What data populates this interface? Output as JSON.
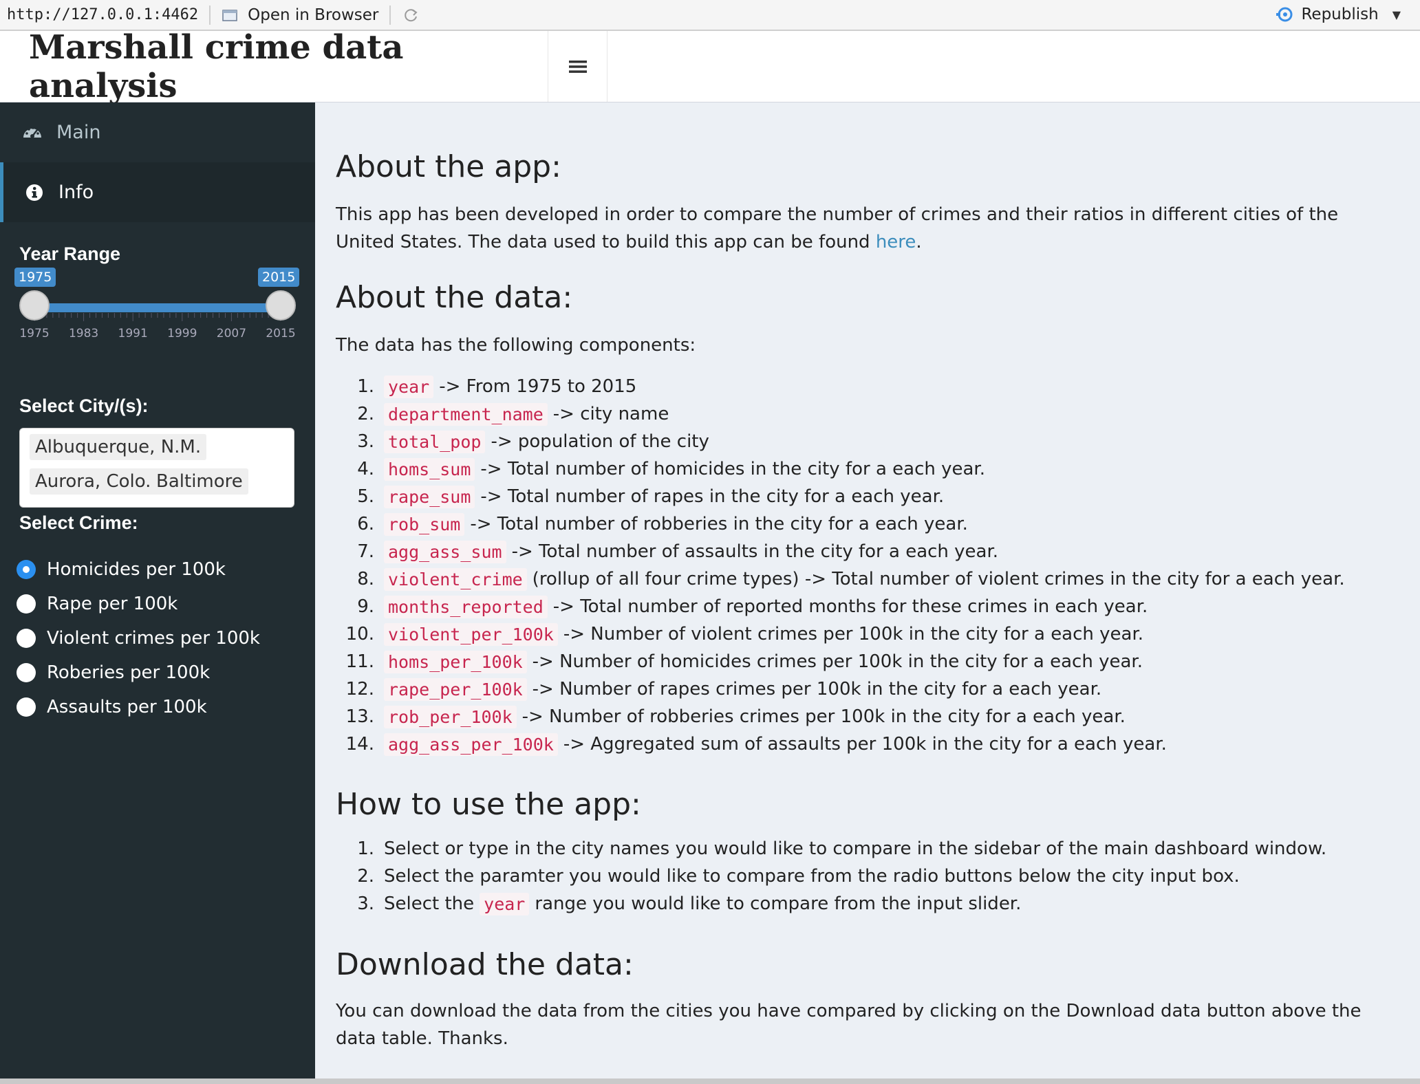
{
  "browser": {
    "url": "http://127.0.0.1:4462",
    "open_in_browser": "Open in Browser",
    "republish": "Republish"
  },
  "header": {
    "title": "Marshall crime data analysis"
  },
  "sidebar": {
    "menu": [
      {
        "label": "Main",
        "icon": "dashboard-icon"
      },
      {
        "label": "Info",
        "icon": "info-circle-icon"
      }
    ],
    "year_range": {
      "label": "Year Range",
      "min_value": "1975",
      "max_value": "2015",
      "ticks": [
        "1975",
        "1983",
        "1991",
        "1999",
        "2007",
        "2015"
      ]
    },
    "city_select": {
      "label": "Select City/(s):",
      "selected": [
        "Albuquerque, N.M.",
        "Aurora, Colo.",
        "Baltimore"
      ]
    },
    "crime_select": {
      "label": "Select Crime:",
      "options": [
        {
          "label": "Homicides per 100k",
          "checked": true
        },
        {
          "label": "Rape per 100k",
          "checked": false
        },
        {
          "label": "Violent crimes per 100k",
          "checked": false
        },
        {
          "label": "Roberies per 100k",
          "checked": false
        },
        {
          "label": "Assaults per 100k",
          "checked": false
        }
      ]
    }
  },
  "content": {
    "about_app": {
      "heading": "About the app:",
      "text_before_link": "This app has been developed in order to compare the number of crimes and their ratios in different cities of the United States. The data used to build this app can be found ",
      "link_text": "here",
      "text_after_link": "."
    },
    "about_data": {
      "heading": "About the data:",
      "intro": "The data has the following components:",
      "items": [
        {
          "num": "1.",
          "code": "year",
          "text": "-> From 1975 to 2015"
        },
        {
          "num": "2.",
          "code": "department_name",
          "text": "-> city name"
        },
        {
          "num": "3.",
          "code": "total_pop",
          "text": "-> population of the city"
        },
        {
          "num": "4.",
          "code": "homs_sum",
          "text": "-> Total number of homicides in the city for a each year."
        },
        {
          "num": "5.",
          "code": "rape_sum",
          "text": "-> Total number of rapes in the city for a each year."
        },
        {
          "num": "6.",
          "code": "rob_sum",
          "text": "-> Total number of robberies in the city for a each year."
        },
        {
          "num": "7.",
          "code": "agg_ass_sum",
          "text": "-> Total number of assaults in the city for a each year."
        },
        {
          "num": "8.",
          "code": "violent_crime",
          "text": "(rollup of all four crime types) -> Total number of violent crimes in the city for a each year."
        },
        {
          "num": "9.",
          "code": "months_reported",
          "text": "-> Total number of reported months for these crimes in each year."
        },
        {
          "num": "10.",
          "code": "violent_per_100k",
          "text": "-> Number of violent crimes per 100k in the city for a each year."
        },
        {
          "num": "11.",
          "code": "homs_per_100k",
          "text": "-> Number of homicides crimes per 100k in the city for a each year."
        },
        {
          "num": "12.",
          "code": "rape_per_100k",
          "text": "-> Number of rapes crimes per 100k in the city for a each year."
        },
        {
          "num": "13.",
          "code": "rob_per_100k",
          "text": "-> Number of robberies crimes per 100k in the city for a each year."
        },
        {
          "num": "14.",
          "code": "agg_ass_per_100k",
          "text": "-> Aggregated sum of assaults per 100k in the city for a each year."
        }
      ]
    },
    "how_to": {
      "heading": "How to use the app:",
      "items": [
        {
          "num": "1.",
          "text": "Select or type in the city names you would like to compare in the sidebar of the main dashboard window."
        },
        {
          "num": "2.",
          "text": "Select the paramter you would like to compare from the radio buttons below the city input box."
        },
        {
          "num": "3.",
          "before": "Select the",
          "code": "year",
          "after": "range you would like to compare from the input slider."
        }
      ]
    },
    "download": {
      "heading": "Download the data:",
      "text": "You can download the data from the cities you have compared by clicking on the Download data button above the data table. Thanks."
    }
  }
}
